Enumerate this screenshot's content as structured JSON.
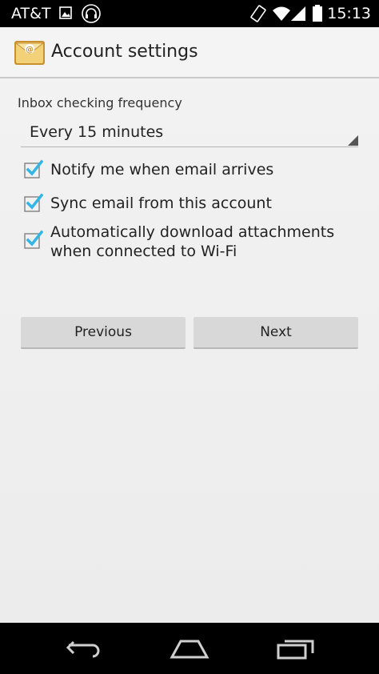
{
  "status_bar": {
    "carrier": "AT&T",
    "time": "15:13",
    "left_icons": [
      "image-icon",
      "headphones-icon"
    ],
    "right_icons": [
      "vibrate-icon",
      "wifi-icon",
      "signal-icon",
      "battery-icon"
    ]
  },
  "action_bar": {
    "title": "Account settings",
    "icon": "email-app-icon"
  },
  "settings": {
    "frequency_label": "Inbox checking frequency",
    "frequency_value": "Every 15 minutes",
    "checkboxes": [
      {
        "label": "Notify me when email arrives",
        "checked": true
      },
      {
        "label": "Sync email from this account",
        "checked": true
      },
      {
        "label_line1": "Automatically download attachments",
        "label_line2": "when connected to Wi-Fi",
        "checked": true
      }
    ]
  },
  "buttons": {
    "previous": "Previous",
    "next": "Next"
  },
  "nav_bar": {
    "buttons": [
      "back-icon",
      "home-icon",
      "recents-icon"
    ]
  },
  "colors": {
    "accent": "#33b5e5",
    "background": "#f2f2f2",
    "button": "#d8d8d8"
  }
}
